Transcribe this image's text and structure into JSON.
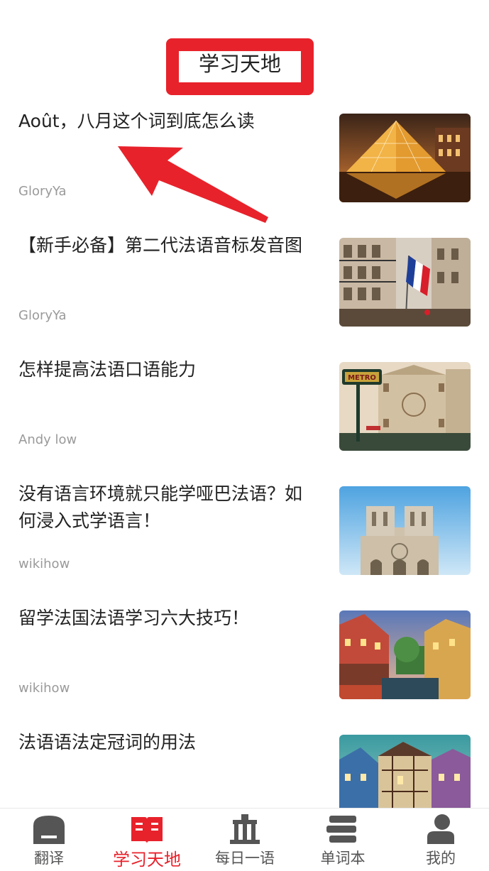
{
  "header": {
    "title": "学习天地"
  },
  "articles": [
    {
      "title": "Août，八月这个词到底怎么读",
      "author": "GloryYa",
      "image_icon": "louvre-pyramid-photo"
    },
    {
      "title": "【新手必备】第二代法语音标发音图",
      "author": "GloryYa",
      "image_icon": "paris-street-flag-photo"
    },
    {
      "title": "怎样提高法语口语能力",
      "author": "Andy low",
      "image_icon": "metro-galeries-lafayette-photo"
    },
    {
      "title": "没有语言环境就只能学哑巴法语？如何浸入式学语言！",
      "author": "wikihow",
      "image_icon": "notre-dame-photo"
    },
    {
      "title": "留学法国法语学习六大技巧！",
      "author": "wikihow",
      "image_icon": "colmar-canal-photo"
    },
    {
      "title": "法语语法定冠词的用法",
      "author": "",
      "image_icon": "colmar-houses-photo"
    }
  ],
  "tabbar": {
    "items": [
      {
        "label": "翻译",
        "icon": "translate-icon"
      },
      {
        "label": "学习天地",
        "icon": "book-icon"
      },
      {
        "label": "每日一语",
        "icon": "tower-icon"
      },
      {
        "label": "单词本",
        "icon": "stack-icon"
      },
      {
        "label": "我的",
        "icon": "user-icon"
      }
    ],
    "active_index": 1
  },
  "colors": {
    "accent": "#e8222b",
    "inactive_icon": "#555555",
    "author_text": "#9a9a9a"
  }
}
